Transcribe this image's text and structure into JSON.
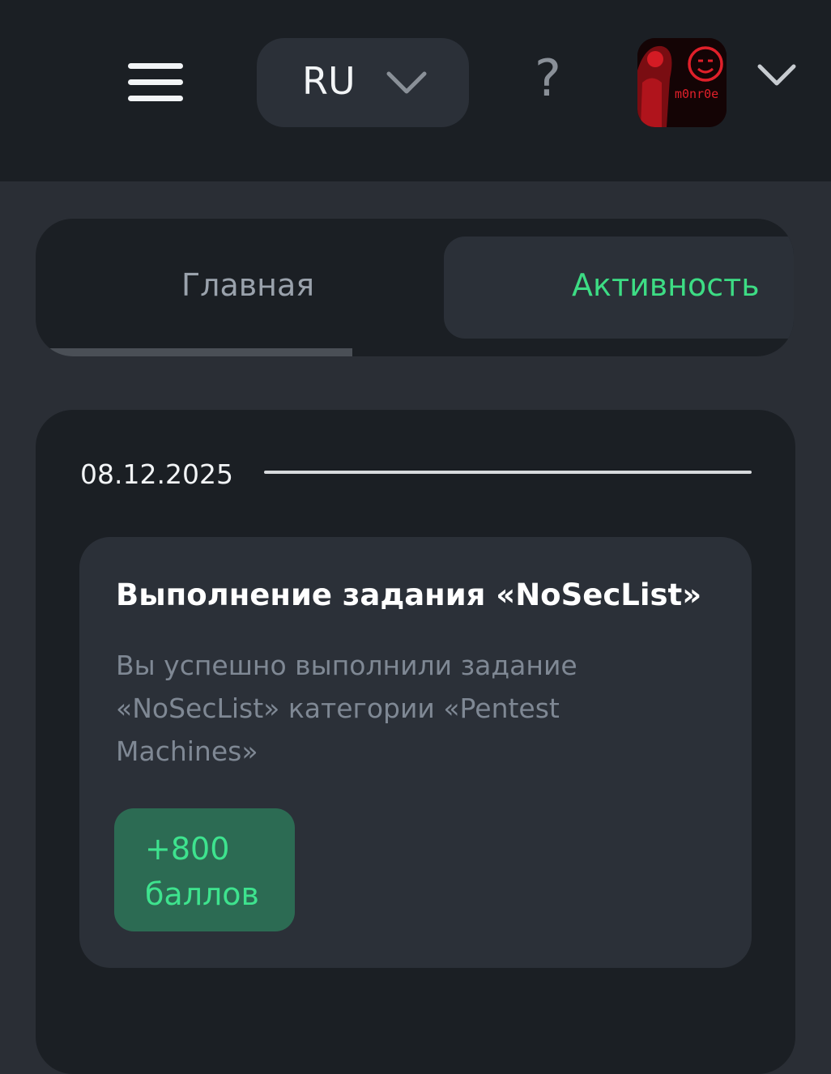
{
  "header": {
    "menu_icon": "hamburger-icon",
    "language": {
      "label": "RU",
      "icon": "chevron-down-icon"
    },
    "help_label": "?",
    "avatar": {
      "text": "m0nr0e"
    },
    "profile_menu_icon": "chevron-down-icon"
  },
  "tabs": [
    {
      "label": "Главная",
      "active": false
    },
    {
      "label": "Активность",
      "active": true
    }
  ],
  "activity": {
    "date": "08.12.2025",
    "item": {
      "title": "Выполнение задания «NoSecList»",
      "description": "Вы успешно выполнили задание «NoSecList» категории «Pentest Machines»",
      "points": "+800 баллов"
    }
  },
  "colors": {
    "accent": "#3ddc84",
    "badge_bg": "#2c6b53",
    "background": "#2a2e35",
    "surface": "#1b1f24"
  }
}
